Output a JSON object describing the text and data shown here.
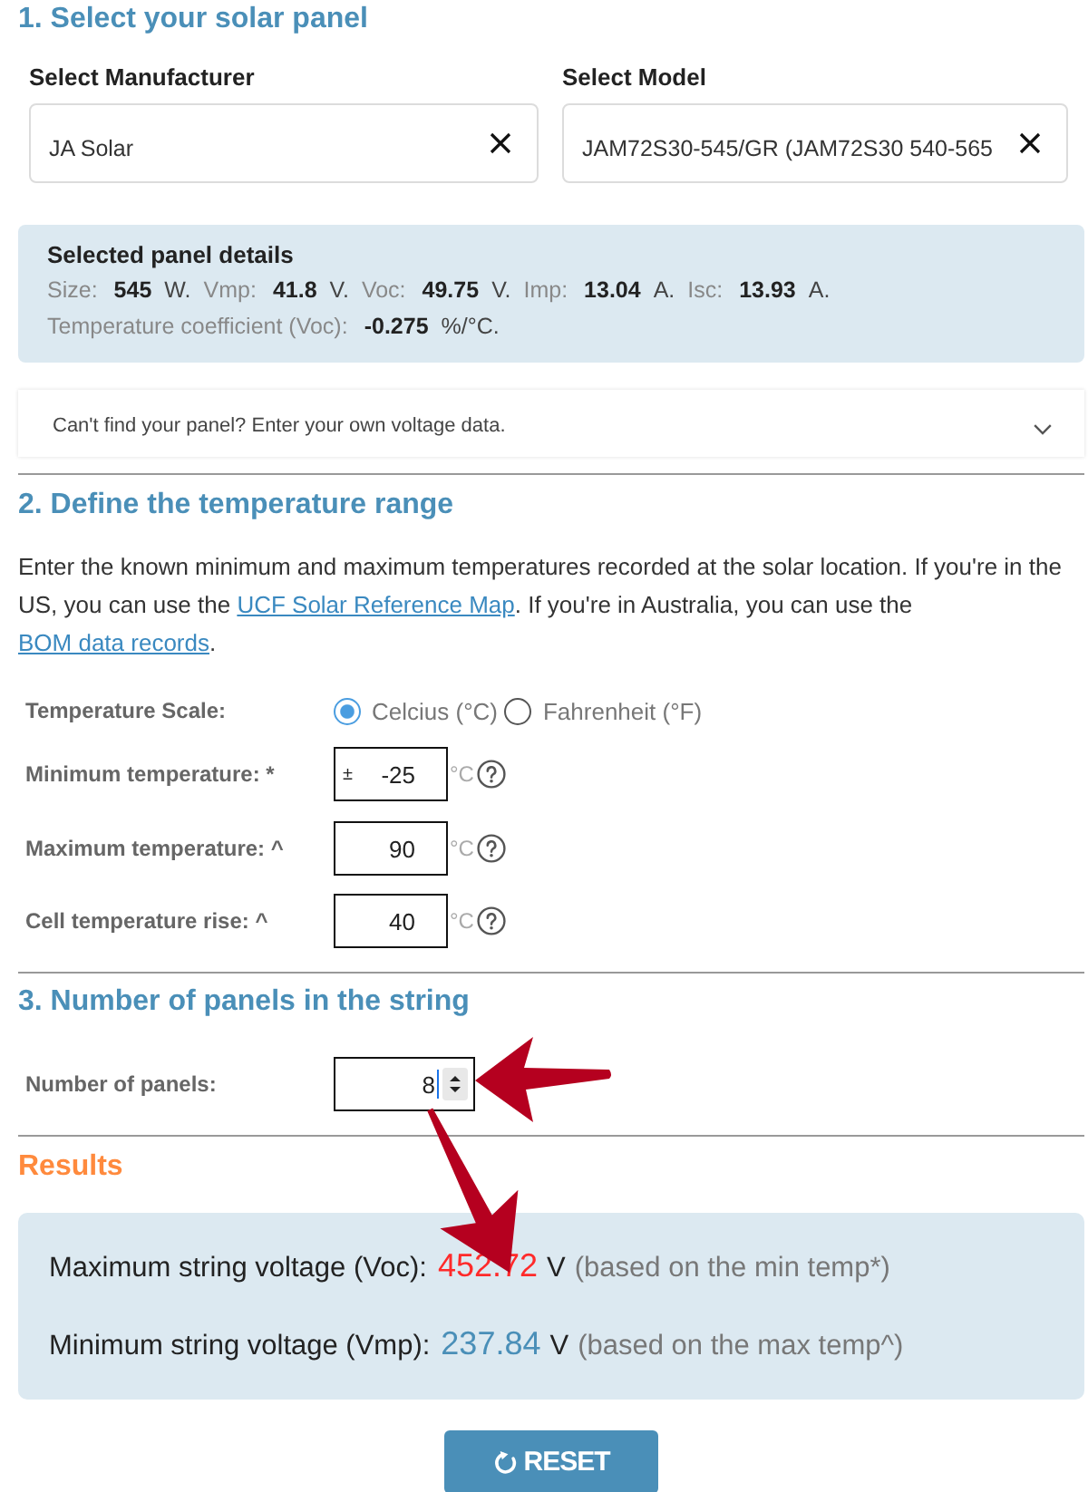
{
  "panel_section": {
    "heading": "1. Select your solar panel",
    "selects": [
      {
        "label": "Select Manufacturer",
        "value": "JA Solar"
      },
      {
        "label": "Select Model",
        "value": "JAM72S30-545/GR (JAM72S30 540-565"
      }
    ]
  },
  "panel_details": {
    "title": "Selected panel details",
    "rows": [
      [
        {
          "label": "Size:",
          "value": "545",
          "unit": "W."
        },
        {
          "label": "Vmp:",
          "value": "41.8",
          "unit": "V."
        },
        {
          "label": "Voc:",
          "value": "49.75",
          "unit": "V."
        },
        {
          "label": "Imp:",
          "value": "13.04",
          "unit": "A."
        },
        {
          "label": "Isc:",
          "value": "13.93",
          "unit": "A."
        }
      ],
      [
        {
          "label": "Temperature coefficient (Voc):",
          "value": "-0.275",
          "unit": "%/°C."
        }
      ]
    ]
  },
  "custom_data_toggle": {
    "text": "Can't find your panel? Enter your own voltage data.",
    "expanded": false
  },
  "temperature_section": {
    "heading": "2. Define the temperature range",
    "intro": [
      {
        "kind": "text",
        "text": "Enter the known minimum and maximum temperatures recorded at the solar location. If you're in the US, you can use the "
      },
      {
        "kind": "link",
        "text": "UCF Solar Reference Map"
      },
      {
        "kind": "text",
        "text": ". If you're in Australia, you can use the "
      },
      {
        "kind": "link",
        "text": "BOM data records"
      },
      {
        "kind": "text",
        "text": "."
      }
    ],
    "scale": {
      "label": "Temperature Scale:",
      "options": [
        {
          "label": "Celcius (°C)",
          "selected": true
        },
        {
          "label": "Fahrenheit (°F)",
          "selected": false
        }
      ]
    },
    "fields": [
      {
        "label": "Minimum temperature: *",
        "prefix": "±",
        "value": "-25",
        "unit": "°C"
      },
      {
        "label": "Maximum temperature: ^",
        "value": "90",
        "unit": "°C"
      },
      {
        "label": "Cell temperature rise: ^",
        "value": "40",
        "unit": "°C"
      }
    ]
  },
  "string_section": {
    "heading": "3. Number of panels in the string",
    "field": {
      "label": "Number of panels:",
      "value": "8",
      "focused": true
    }
  },
  "results": {
    "heading": "Results",
    "lines": [
      {
        "label": "Maximum string voltage (Voc):",
        "value": "452.72",
        "unit": "V",
        "note": "(based on the min temp*)",
        "color": "#ff2a2a"
      },
      {
        "label": "Minimum string voltage (Vmp):",
        "value": "237.84",
        "unit": "V",
        "note": "(based on the max temp^)",
        "color": "#4a8fb8"
      }
    ]
  },
  "reset_button": {
    "label": "RESET"
  }
}
